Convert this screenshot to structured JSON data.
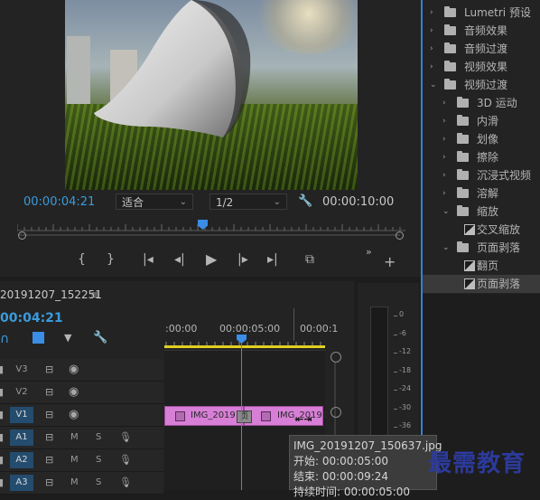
{
  "program_monitor": {
    "timecode_current": "00:00:04:21",
    "zoom_select": "适合",
    "resolution_select": "1/2",
    "timecode_duration": "00:00:10:00"
  },
  "effects_panel": {
    "items": [
      {
        "label": "Lumetri 预设",
        "level": 0,
        "kind": "folder-star",
        "expanded": false
      },
      {
        "label": "音频效果",
        "level": 0,
        "kind": "folder",
        "expanded": false
      },
      {
        "label": "音频过渡",
        "level": 0,
        "kind": "folder",
        "expanded": false
      },
      {
        "label": "视频效果",
        "level": 0,
        "kind": "folder",
        "expanded": false
      },
      {
        "label": "视频过渡",
        "level": 0,
        "kind": "folder",
        "expanded": true
      },
      {
        "label": "3D 运动",
        "level": 1,
        "kind": "folder",
        "expanded": false
      },
      {
        "label": "内滑",
        "level": 1,
        "kind": "folder",
        "expanded": false
      },
      {
        "label": "划像",
        "level": 1,
        "kind": "folder",
        "expanded": false
      },
      {
        "label": "擦除",
        "level": 1,
        "kind": "folder",
        "expanded": false
      },
      {
        "label": "沉浸式视频",
        "level": 1,
        "kind": "folder",
        "expanded": false
      },
      {
        "label": "溶解",
        "level": 1,
        "kind": "folder",
        "expanded": false
      },
      {
        "label": "缩放",
        "level": 1,
        "kind": "folder",
        "expanded": true
      },
      {
        "label": "交叉缩放",
        "level": 2,
        "kind": "effect",
        "expanded": false
      },
      {
        "label": "页面剥落",
        "level": 1,
        "kind": "folder",
        "expanded": true
      },
      {
        "label": "翻页",
        "level": 2,
        "kind": "effect",
        "expanded": false
      },
      {
        "label": "页面剥落",
        "level": 2,
        "kind": "effect",
        "expanded": false,
        "selected": true
      }
    ]
  },
  "timeline": {
    "sequence_name": "20191207_152251",
    "timecode": "00:04:21",
    "ruler": [
      ":00:00",
      "00:00:05:00",
      "00:00:1"
    ],
    "tracks": [
      {
        "name": "V3",
        "type": "video"
      },
      {
        "name": "V2",
        "type": "video"
      },
      {
        "name": "V1",
        "type": "video",
        "active": true
      },
      {
        "name": "A1",
        "type": "audio",
        "m": "M",
        "s": "S"
      },
      {
        "name": "A2",
        "type": "audio",
        "m": "M",
        "s": "S"
      },
      {
        "name": "A3",
        "type": "audio",
        "m": "M",
        "s": "S"
      }
    ],
    "clips": [
      {
        "label": "IMG_20191"
      },
      {
        "label": "IMG_20191"
      }
    ],
    "transition_label": "页"
  },
  "meters": {
    "scale": [
      "0",
      "-6",
      "-12",
      "-18",
      "-24",
      "-30",
      "-36"
    ]
  },
  "tooltip": {
    "name": "IMG_20191207_150637.jpg",
    "start": "开始: 00:00:05:00",
    "end": "结束: 00:00:09:24",
    "duration": "持续时间: 00:00:05:00"
  },
  "watermark": "最需教育",
  "colors": {
    "accent_blue": "#3a9bdc",
    "clip_pink": "#d77fd7",
    "playhead": "#3a8ee6",
    "work_area_yellow": "#e0d020"
  }
}
